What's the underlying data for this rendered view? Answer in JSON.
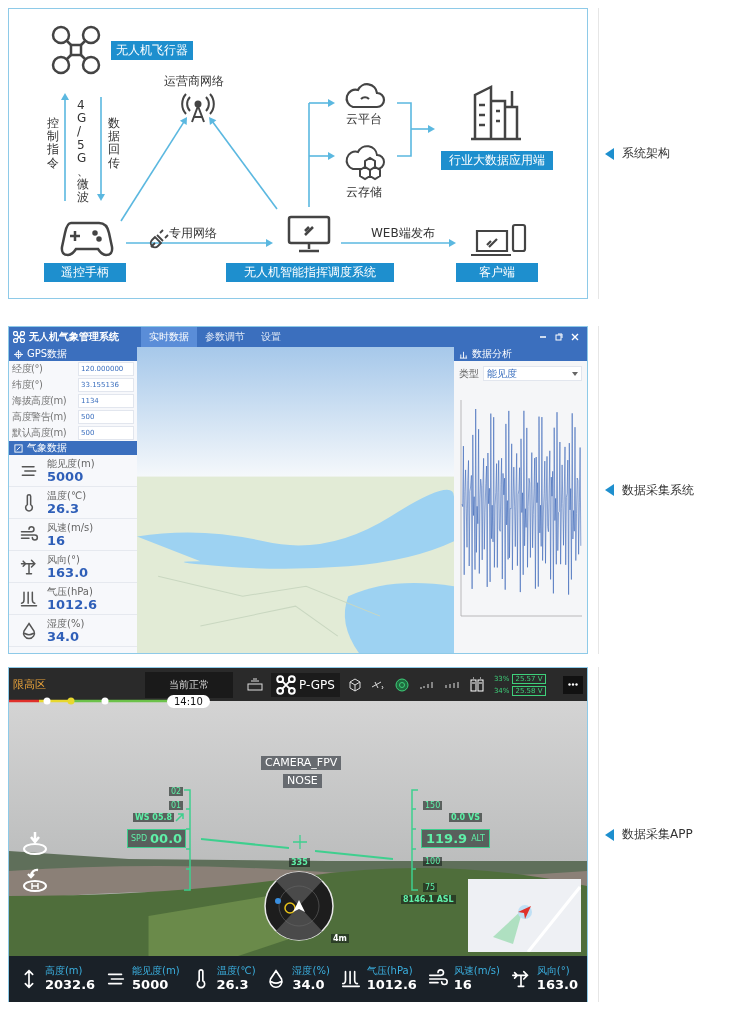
{
  "architecture": {
    "side_label": "系统架构",
    "drone": "无人机飞行器",
    "uplink_label": "控制指令",
    "link_label": "4G/5G、微波",
    "downlink_label": "数据回传",
    "carrier": "运营商网络",
    "controller": "遥控手柄",
    "private_net": "专用网络",
    "command_system": "无人机智能指挥调度系统",
    "cloud_platform": "云平台",
    "cloud_storage": "云存储",
    "bigdata": "行业大数据应用端",
    "web_publish": "WEB端发布",
    "client": "客户端"
  },
  "collection_system": {
    "side_label": "数据采集系统",
    "title": "无人机气象管理系统",
    "tabs": [
      {
        "label": "实时数据",
        "selected": true
      },
      {
        "label": "参数调节",
        "selected": false
      },
      {
        "label": "设置",
        "selected": false
      }
    ],
    "gps_section": {
      "title": "GPS数据",
      "fields": [
        {
          "label": "经度(°)",
          "value": "120.000000"
        },
        {
          "label": "纬度(°)",
          "value": "33.155136"
        },
        {
          "label": "海拔高度(m)",
          "value": "1134"
        },
        {
          "label": "高度警告(m)",
          "value": "500"
        },
        {
          "label": "默认高度(m)",
          "value": "500"
        }
      ]
    },
    "weather_section": {
      "title": "气象数据",
      "items": [
        {
          "kind": "visibility",
          "label": "能见度(m)",
          "value": "5000"
        },
        {
          "kind": "temperature",
          "label": "温度(℃)",
          "value": "26.3"
        },
        {
          "kind": "wind_speed",
          "label": "风速(m/s)",
          "value": "16"
        },
        {
          "kind": "wind_direction",
          "label": "风向(°)",
          "value": "163.0"
        },
        {
          "kind": "pressure",
          "label": "气压(hPa)",
          "value": "1012.6"
        },
        {
          "kind": "humidity",
          "label": "湿度(%)",
          "value": "34.0"
        }
      ]
    },
    "analysis": {
      "title": "数据分析",
      "filter_label": "类型",
      "filter_value": "能见度"
    }
  },
  "app": {
    "side_label": "数据采集APP",
    "zone": "限高区",
    "status": "当前正常",
    "gps_mode": "P-GPS",
    "batteries": [
      {
        "percent": "33%",
        "voltage": "25.57 V"
      },
      {
        "percent": "34%",
        "voltage": "25.58 V"
      }
    ],
    "time": "14:10",
    "camera": "CAMERA_FPV",
    "view": "NOSE",
    "wind": "WS 05.8",
    "speed_label": "SPD",
    "speed": "00.0",
    "speed_ticks": [
      "02",
      "01"
    ],
    "vertical_speed": "0.0 VS",
    "altitude": "119.9",
    "altitude_label": "ALT",
    "altitude_ticks": [
      "150",
      "100",
      "75"
    ],
    "heading": "335",
    "asl": "8146.1 ASL",
    "distance": "4m",
    "telemetry": [
      {
        "kind": "altitude",
        "label": "高度(m)",
        "value": "2032.6"
      },
      {
        "kind": "visibility",
        "label": "能见度(m)",
        "value": "5000"
      },
      {
        "kind": "temperature",
        "label": "温度(℃)",
        "value": "26.3"
      },
      {
        "kind": "humidity",
        "label": "湿度(%)",
        "value": "34.0"
      },
      {
        "kind": "pressure",
        "label": "气压(hPa)",
        "value": "1012.6"
      },
      {
        "kind": "wind_speed",
        "label": "风速(m/s)",
        "value": "16"
      },
      {
        "kind": "wind_direction",
        "label": "风向(°)",
        "value": "163.0"
      }
    ]
  }
}
